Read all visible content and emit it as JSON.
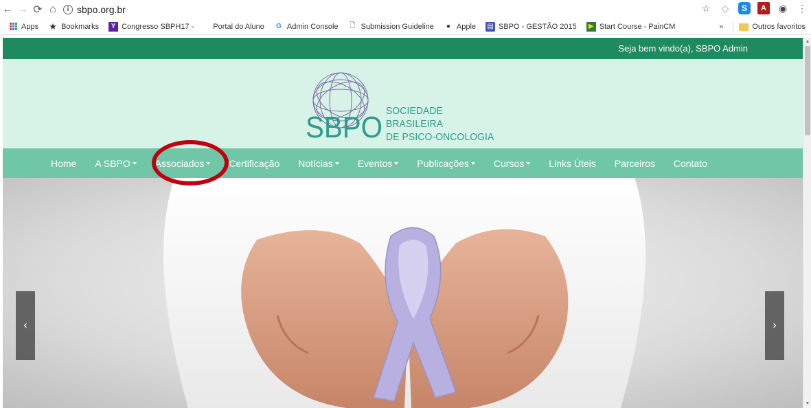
{
  "browser": {
    "url": "sbpo.org.br",
    "bookmarks": [
      {
        "label": "Apps",
        "icon": "apps-grid-icon"
      },
      {
        "label": "Bookmarks",
        "icon": "star-icon"
      },
      {
        "label": "Congresso SBPH17 - ",
        "icon": "yahoo-icon"
      },
      {
        "label": "Portal do Aluno",
        "icon": "blank-page-icon"
      },
      {
        "label": "Admin Console",
        "icon": "google-icon"
      },
      {
        "label": "Submission Guideline",
        "icon": "document-icon"
      },
      {
        "label": "Apple",
        "icon": "apple-icon"
      },
      {
        "label": "SBPO - GESTÃO 2015",
        "icon": "sbpo-icon"
      },
      {
        "label": "Start Course - PainCM",
        "icon": "course-icon"
      }
    ],
    "overflow": "»",
    "other_bookmarks": "Outros favoritos"
  },
  "site": {
    "welcome": "Seja bem vindo(a), SBPO Admin",
    "logo": {
      "mark": "SBPO",
      "line1": "SOCIEDADE BRASILEIRA",
      "line2": "DE PSICO-ONCOLOGIA"
    },
    "nav": [
      {
        "label": "Home",
        "dropdown": false
      },
      {
        "label": "A SBPO",
        "dropdown": true
      },
      {
        "label": "Associados",
        "dropdown": true
      },
      {
        "label": "Certificação",
        "dropdown": false
      },
      {
        "label": "Notícias",
        "dropdown": true
      },
      {
        "label": "Eventos",
        "dropdown": true
      },
      {
        "label": "Publicações",
        "dropdown": true
      },
      {
        "label": "Cursos",
        "dropdown": true
      },
      {
        "label": "Links Úteis",
        "dropdown": false
      },
      {
        "label": "Parceiros",
        "dropdown": false
      },
      {
        "label": "Contato",
        "dropdown": false
      }
    ],
    "carousel": {
      "prev": "‹",
      "next": "›"
    }
  },
  "colors": {
    "topbar": "#1f8a5f",
    "header": "#d7f2e6",
    "navbar": "#6fc7a8",
    "highlight": "#c00010",
    "ribbon": "#b8b0e0"
  }
}
